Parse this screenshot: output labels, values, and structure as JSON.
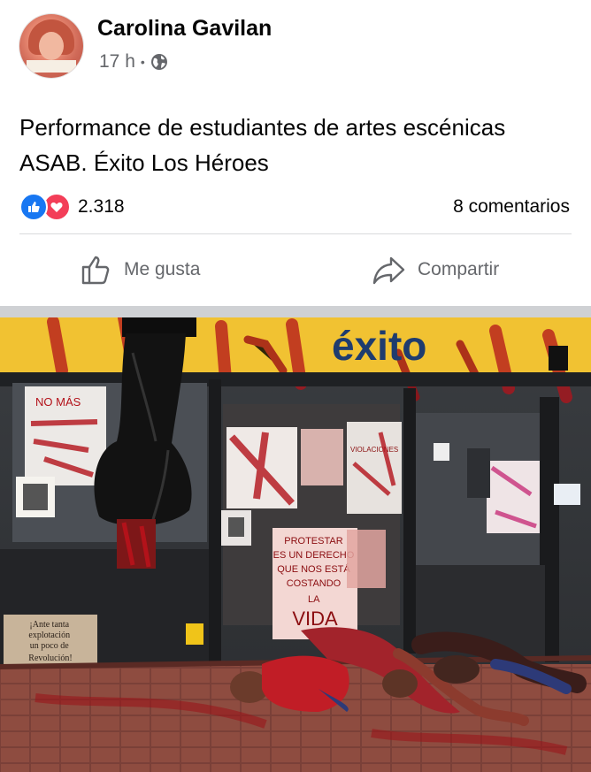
{
  "post": {
    "author": "Carolina Gavilan",
    "time": "17 h",
    "separator": "•",
    "privacy_icon": "globe-icon",
    "text": "Performance de estudiantes de artes escénicas ASAB. Éxito Los Héroes",
    "reaction_count": "2.318",
    "comments": "8 comentarios"
  },
  "actions": {
    "like_label": "Me gusta",
    "share_label": "Compartir"
  },
  "photo": {
    "store_sign": "éxito",
    "poster_left": "NO MÁS",
    "poster_center": "VIOLACIONES",
    "poster_main": [
      "PROTESTAR",
      "ES UN DERECHO",
      "QUE NOS ESTÁ",
      "COSTANDO",
      "LA",
      "VIDA"
    ],
    "poster_cardboard": [
      "¡Ante tanta",
      "explotación",
      "un poco de",
      "Revolución!"
    ]
  },
  "colors": {
    "like": "#1877f2",
    "love": "#f33e58",
    "secondary_text": "#65676b",
    "blood": "#b3121a",
    "sign_yellow": "#f1c232"
  }
}
